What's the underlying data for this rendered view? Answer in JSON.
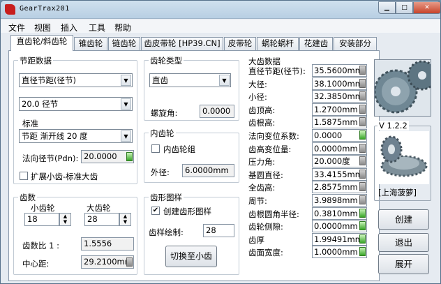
{
  "window": {
    "title": "GearTrax201"
  },
  "menu": [
    "文件",
    "视图",
    "插入",
    "工具",
    "帮助"
  ],
  "tabs": [
    "直齿轮/斜齿轮",
    "锥齿轮",
    "链齿轮",
    "齿皮带轮 [HP39.CN]",
    "皮带轮",
    "蜗轮蜗杆",
    "花建齿",
    "安装部分"
  ],
  "pitch": {
    "title": "节距数据",
    "type_select": "直径节距(径节)",
    "value_select": "20.0 径节",
    "standard_label": "标准",
    "standard_select": "节距 渐开线 20 度",
    "normal_pitch_label": "法向径节(Pdn):",
    "normal_pitch_value": "20.0000",
    "extend_label": "扩展小齿-标准大齿"
  },
  "teeth": {
    "title": "齿数",
    "pinion_label": "小齿轮",
    "gear_label": "大齿轮",
    "pinion_value": "18",
    "gear_value": "28",
    "ratio_label": "齿数比 1 :",
    "ratio_value": "1.5556",
    "center_label": "中心距:",
    "center_value": "29.2100mm"
  },
  "gear_type": {
    "title": "齿轮类型",
    "type_select": "直齿",
    "helix_label": "螺旋角:",
    "helix_value": "0.0000"
  },
  "internal": {
    "title": "内齿轮",
    "group_label": "内齿轮组",
    "od_label": "外径:",
    "od_value": "6.0000mm"
  },
  "profile": {
    "title": "齿形图样",
    "create_label": "创建齿形图样",
    "draw_label": "齿样绘制:",
    "draw_value": "28",
    "switch_button": "切换至小齿"
  },
  "gear_data": {
    "title": "大齿数据",
    "rows": [
      {
        "label": "直径节距(径节):",
        "value": "35.5600mm",
        "green": false
      },
      {
        "label": "大径:",
        "value": "38.1000mm",
        "green": false
      },
      {
        "label": "小径:",
        "value": "32.3850mm",
        "green": false
      },
      {
        "label": "齿顶高:",
        "value": "1.2700mm",
        "green": false
      },
      {
        "label": "齿根高:",
        "value": "1.5875mm",
        "green": false
      },
      {
        "label": "法向变位系数:",
        "value": "0.0000",
        "green": true
      },
      {
        "label": "齿高变位量:",
        "value": "0.0000mm",
        "green": false
      },
      {
        "label": "压力角:",
        "value": "20.000度",
        "green": false
      },
      {
        "label": "基圆直径:",
        "value": "33.4155mm",
        "green": false
      },
      {
        "label": "全齿高:",
        "value": "2.8575mm",
        "green": false
      },
      {
        "label": "周节:",
        "value": "3.9898mm",
        "green": false
      },
      {
        "label": "齿根圆角半径:",
        "value": "0.3810mm",
        "green": true
      },
      {
        "label": "齿轮侧隙:",
        "value": "0.0000mm",
        "green": true
      },
      {
        "label": "齿厚",
        "value": "1.99491mm",
        "green": true
      },
      {
        "label": "齿面宽度:",
        "value": "1.0000mm",
        "green": true
      }
    ]
  },
  "side": {
    "version": "V 1.2.2",
    "caption": "[上海菠萝]",
    "create_button": "创建",
    "exit_button": "退出",
    "expand_button": "展开"
  },
  "colors": {
    "accent_green": "#38a628",
    "close_red": "#c8442b"
  }
}
